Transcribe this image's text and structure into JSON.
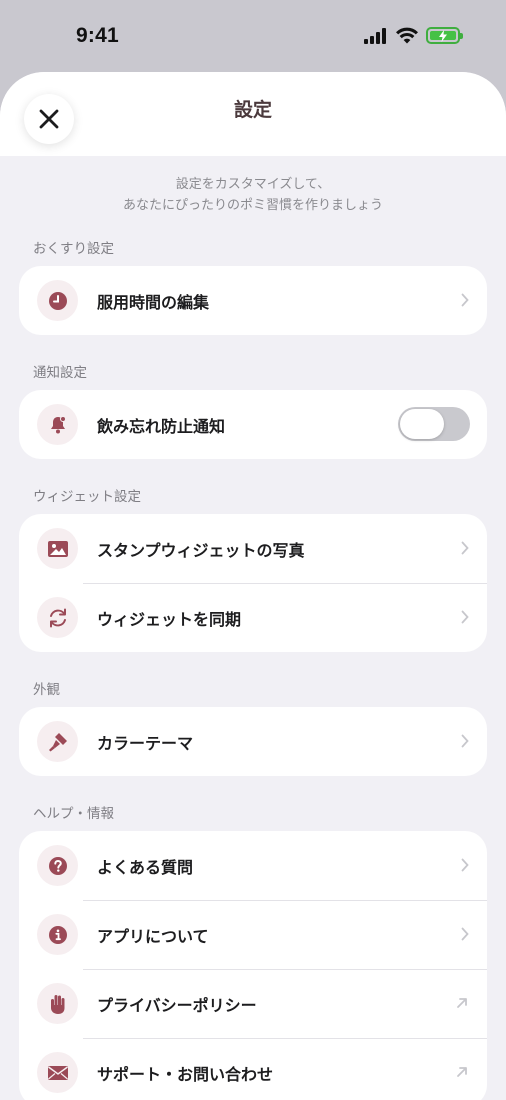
{
  "status_bar": {
    "time": "9:41"
  },
  "header": {
    "title": "設定"
  },
  "intro": {
    "line1": "設定をカスタマイズして、",
    "line2": "あなたにぴったりのポミ習慣を作りましょう"
  },
  "sections": {
    "medicine": {
      "label": "おくすり設定",
      "rows": [
        {
          "label": "服用時間の編集"
        }
      ]
    },
    "notification": {
      "label": "通知設定",
      "rows": [
        {
          "label": "飲み忘れ防止通知",
          "toggle_on": false
        }
      ]
    },
    "widget": {
      "label": "ウィジェット設定",
      "rows": [
        {
          "label": "スタンプウィジェットの写真"
        },
        {
          "label": "ウィジェットを同期"
        }
      ]
    },
    "appearance": {
      "label": "外観",
      "rows": [
        {
          "label": "カラーテーマ"
        }
      ]
    },
    "help": {
      "label": "ヘルプ・情報",
      "rows": [
        {
          "label": "よくある質問"
        },
        {
          "label": "アプリについて"
        },
        {
          "label": "プライバシーポリシー"
        },
        {
          "label": "サポート・お問い合わせ"
        }
      ]
    }
  },
  "colors": {
    "accent": "#9b4a57",
    "icon_bg": "#f6eef0",
    "background": "#f1f0f5"
  },
  "icons": [
    "clock-icon",
    "bell-icon",
    "photo-icon",
    "sync-icon",
    "paint-icon",
    "question-icon",
    "info-icon",
    "hand-icon",
    "mail-icon",
    "chevron-right-icon",
    "external-link-icon",
    "close-icon"
  ]
}
